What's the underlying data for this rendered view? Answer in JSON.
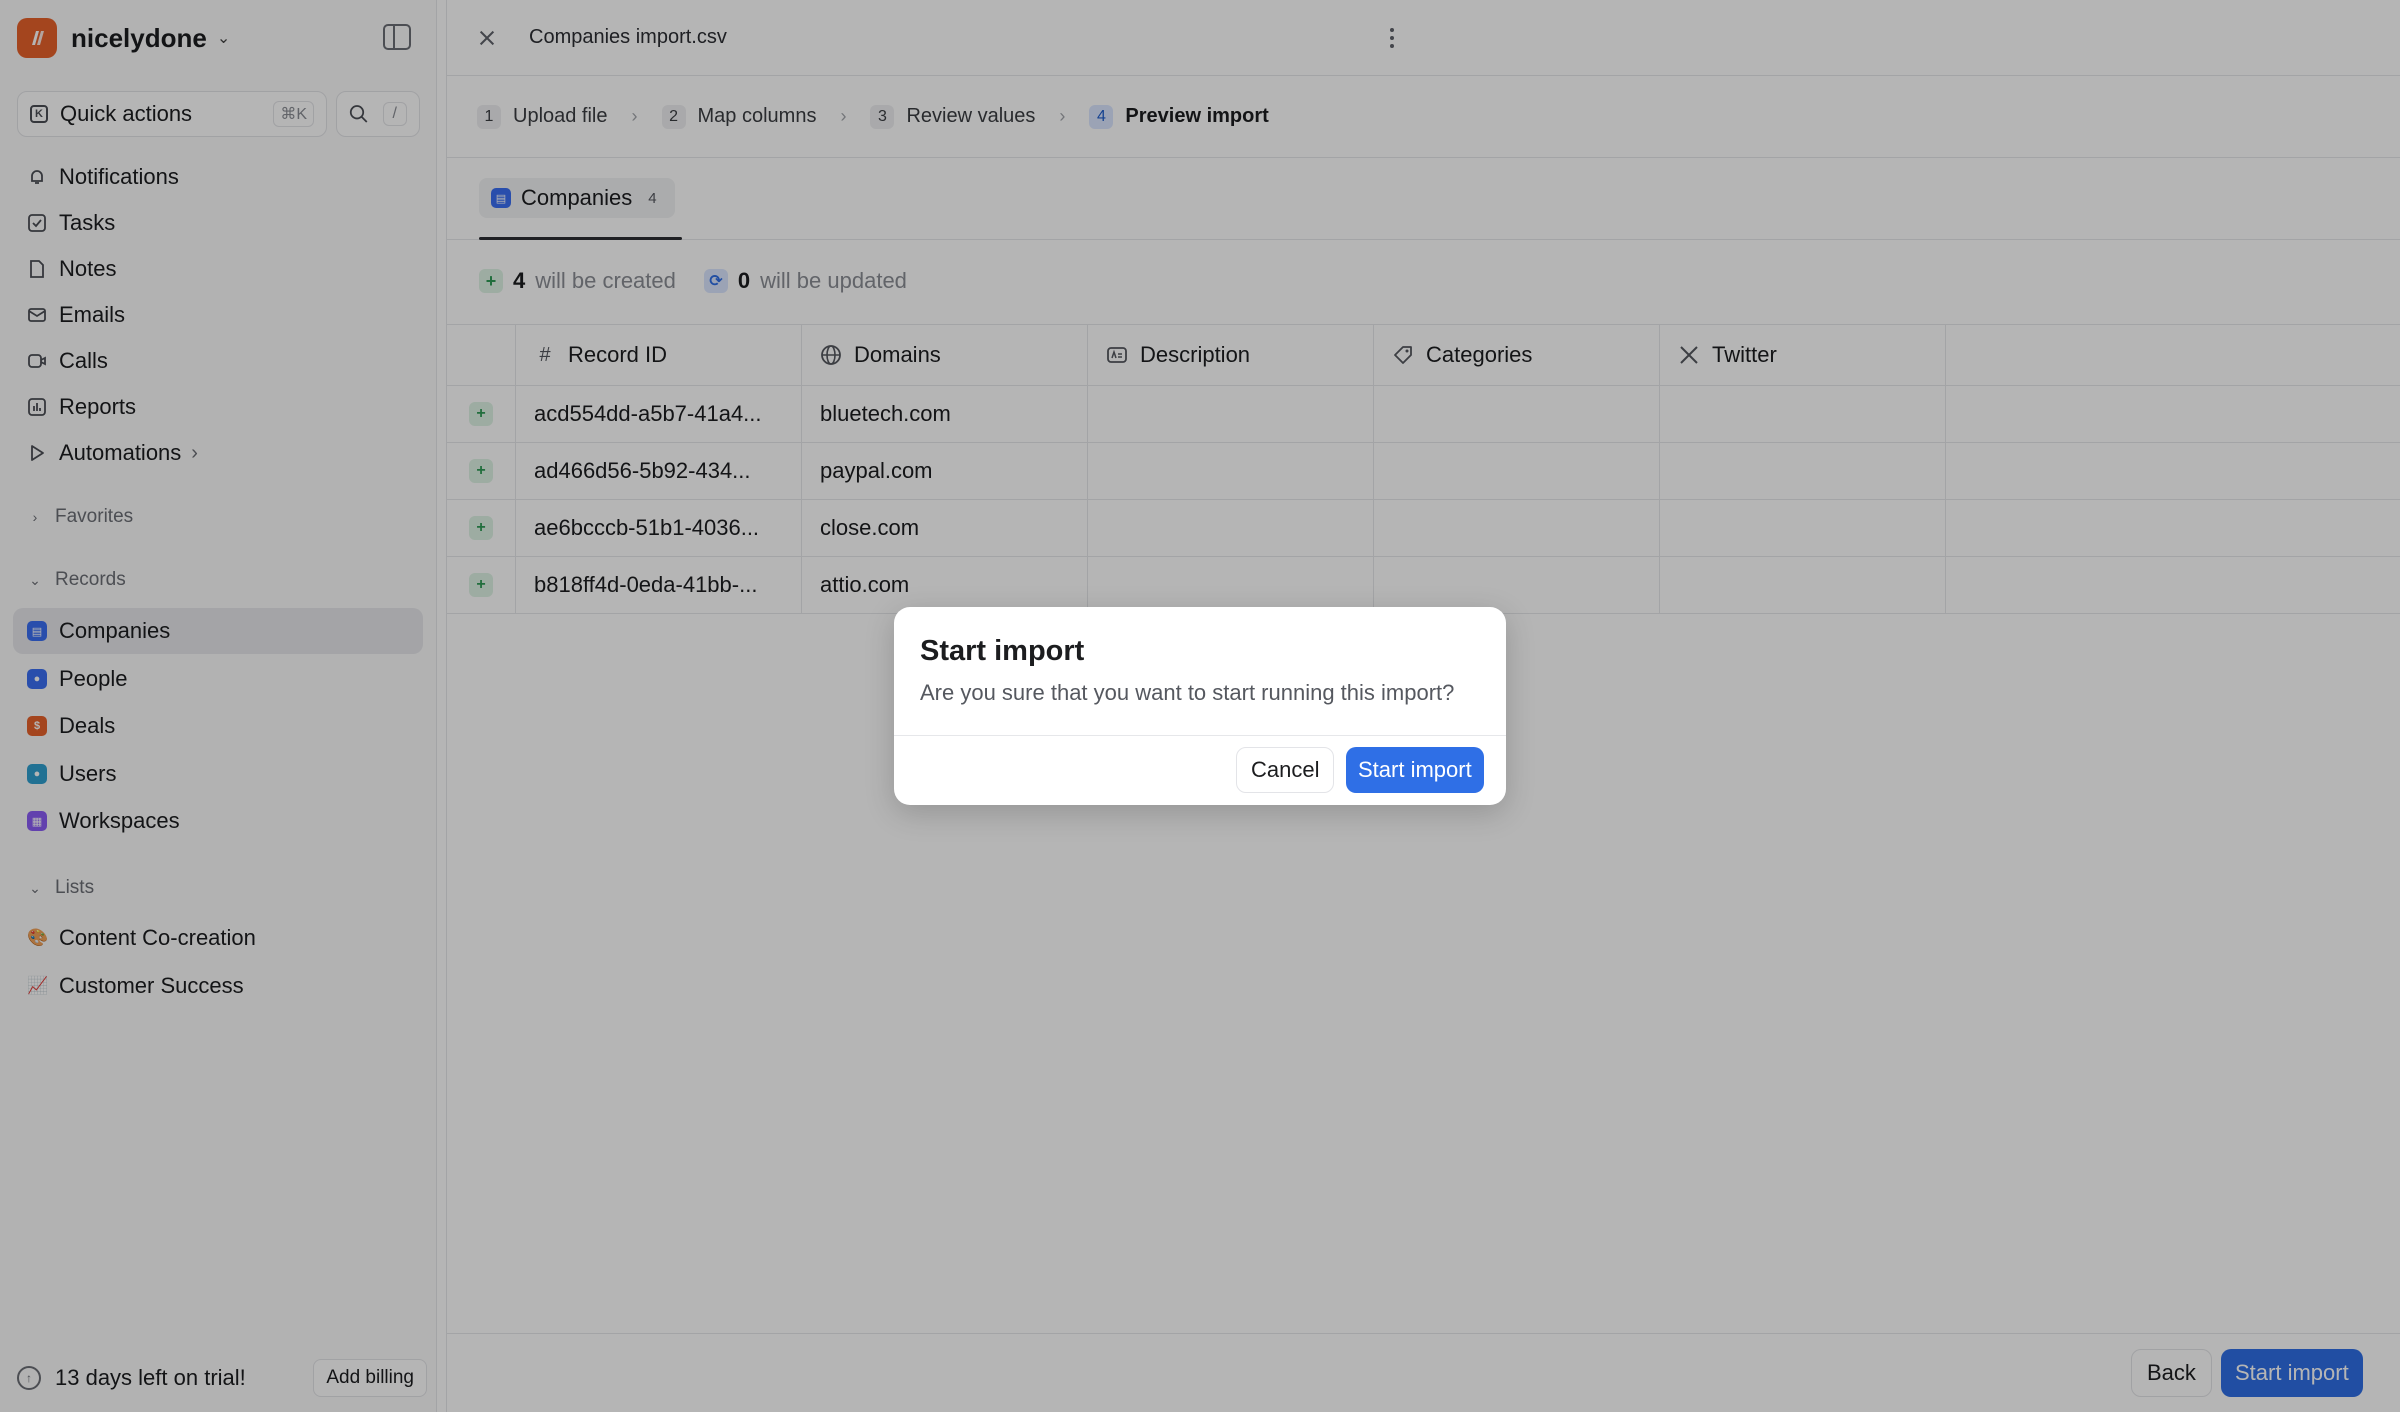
{
  "workspace": {
    "name": "nicelydone"
  },
  "sidebar": {
    "quick_actions": {
      "label": "Quick actions",
      "shortcut": "⌘K"
    },
    "search": {
      "shortcut": "/"
    },
    "nav": [
      {
        "label": "Notifications",
        "icon": "bell-icon"
      },
      {
        "label": "Tasks",
        "icon": "checkbox-icon"
      },
      {
        "label": "Notes",
        "icon": "note-icon"
      },
      {
        "label": "Emails",
        "icon": "mail-icon"
      },
      {
        "label": "Calls",
        "icon": "video-icon"
      },
      {
        "label": "Reports",
        "icon": "chart-icon"
      },
      {
        "label": "Automations",
        "icon": "play-icon"
      }
    ],
    "favorites_label": "Favorites",
    "records_label": "Records",
    "records": [
      {
        "label": "Companies",
        "color": "#3b6ff2",
        "active": true
      },
      {
        "label": "People",
        "color": "#3b6ff2"
      },
      {
        "label": "Deals",
        "color": "#e8622b"
      },
      {
        "label": "Users",
        "color": "#2f9fd0"
      },
      {
        "label": "Workspaces",
        "color": "#8b5cf6"
      }
    ],
    "lists_label": "Lists",
    "lists": [
      {
        "label": "Content Co-creation",
        "emoji": "🎨"
      },
      {
        "label": "Customer Success",
        "emoji": "📈"
      }
    ],
    "trial": {
      "text": "13 days left on trial!",
      "button": "Add billing"
    }
  },
  "main": {
    "file_title": "Companies import.csv",
    "steps": [
      {
        "num": "1",
        "label": "Upload file"
      },
      {
        "num": "2",
        "label": "Map columns"
      },
      {
        "num": "3",
        "label": "Review values"
      },
      {
        "num": "4",
        "label": "Preview import",
        "active": true
      }
    ],
    "tab": {
      "label": "Companies",
      "count": "4"
    },
    "summary": {
      "created_count": "4",
      "created_text": "will be created",
      "updated_count": "0",
      "updated_text": "will be updated"
    },
    "columns": [
      {
        "label": "Record ID",
        "icon": "#"
      },
      {
        "label": "Domains",
        "icon": "globe-icon"
      },
      {
        "label": "Description",
        "icon": "text-icon"
      },
      {
        "label": "Categories",
        "icon": "tag-icon"
      },
      {
        "label": "Twitter",
        "icon": "x-icon"
      }
    ],
    "rows": [
      {
        "record_id": "acd554dd-a5b7-41a4...",
        "domain": "bluetech.com"
      },
      {
        "record_id": "ad466d56-5b92-434...",
        "domain": "paypal.com"
      },
      {
        "record_id": "ae6bcccb-51b1-4036...",
        "domain": "close.com"
      },
      {
        "record_id": "b818ff4d-0eda-41bb-...",
        "domain": "attio.com"
      }
    ],
    "footer": {
      "back": "Back",
      "start": "Start import"
    }
  },
  "dialog": {
    "title": "Start import",
    "body": "Are you sure that you want to start running this import?",
    "cancel": "Cancel",
    "confirm": "Start import"
  }
}
